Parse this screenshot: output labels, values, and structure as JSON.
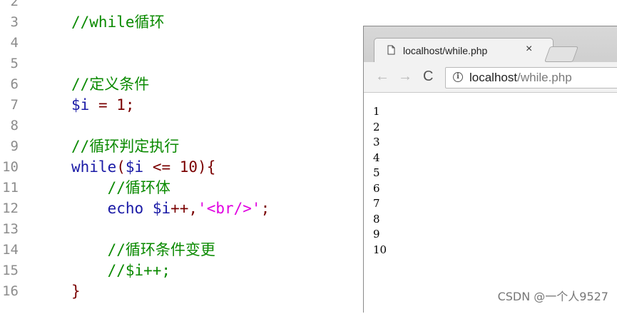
{
  "editor": {
    "lines": [
      {
        "num": "2",
        "tokens": []
      },
      {
        "num": "3",
        "tokens": [
          {
            "t": "//while循环",
            "c": "c-comment"
          }
        ]
      },
      {
        "num": "4",
        "tokens": []
      },
      {
        "num": "5",
        "tokens": []
      },
      {
        "num": "6",
        "tokens": [
          {
            "t": "//定义条件",
            "c": "c-comment"
          }
        ]
      },
      {
        "num": "7",
        "tokens": [
          {
            "t": "$i",
            "c": "c-var"
          },
          {
            "t": " = ",
            "c": "c-op"
          },
          {
            "t": "1",
            "c": "c-num"
          },
          {
            "t": ";",
            "c": "c-plain"
          }
        ]
      },
      {
        "num": "8",
        "tokens": []
      },
      {
        "num": "9",
        "tokens": [
          {
            "t": "//循环判定执行",
            "c": "c-comment"
          }
        ]
      },
      {
        "num": "10",
        "tokens": [
          {
            "t": "while",
            "c": "c-kw"
          },
          {
            "t": "(",
            "c": "c-plain"
          },
          {
            "t": "$i",
            "c": "c-var"
          },
          {
            "t": " <= ",
            "c": "c-op"
          },
          {
            "t": "10",
            "c": "c-num"
          },
          {
            "t": "){",
            "c": "c-plain"
          }
        ]
      },
      {
        "num": "11",
        "tokens": [
          {
            "t": "    ",
            "c": "c-plain"
          },
          {
            "t": "//循环体",
            "c": "c-comment"
          }
        ]
      },
      {
        "num": "12",
        "tokens": [
          {
            "t": "    ",
            "c": "c-plain"
          },
          {
            "t": "echo",
            "c": "c-kw"
          },
          {
            "t": " ",
            "c": "c-plain"
          },
          {
            "t": "$i",
            "c": "c-var"
          },
          {
            "t": "++,",
            "c": "c-op"
          },
          {
            "t": "'<br/>'",
            "c": "c-str"
          },
          {
            "t": ";",
            "c": "c-plain"
          }
        ]
      },
      {
        "num": "13",
        "tokens": []
      },
      {
        "num": "14",
        "tokens": [
          {
            "t": "    ",
            "c": "c-plain"
          },
          {
            "t": "//循环条件变更",
            "c": "c-comment"
          }
        ]
      },
      {
        "num": "15",
        "tokens": [
          {
            "t": "    ",
            "c": "c-plain"
          },
          {
            "t": "//$i++;",
            "c": "c-comment"
          }
        ]
      },
      {
        "num": "16",
        "tokens": [
          {
            "t": "}",
            "c": "c-plain"
          }
        ]
      }
    ]
  },
  "browser": {
    "tab_title": "localhost/while.php",
    "tab_close": "×",
    "back_icon": "←",
    "forward_icon": "→",
    "reload_icon": "C",
    "info_icon": "i",
    "url_host": "localhost",
    "url_path": "/while.php",
    "output_lines": [
      "1",
      "2",
      "3",
      "4",
      "5",
      "6",
      "7",
      "8",
      "9",
      "10"
    ]
  },
  "watermark": "CSDN @一个人9527"
}
